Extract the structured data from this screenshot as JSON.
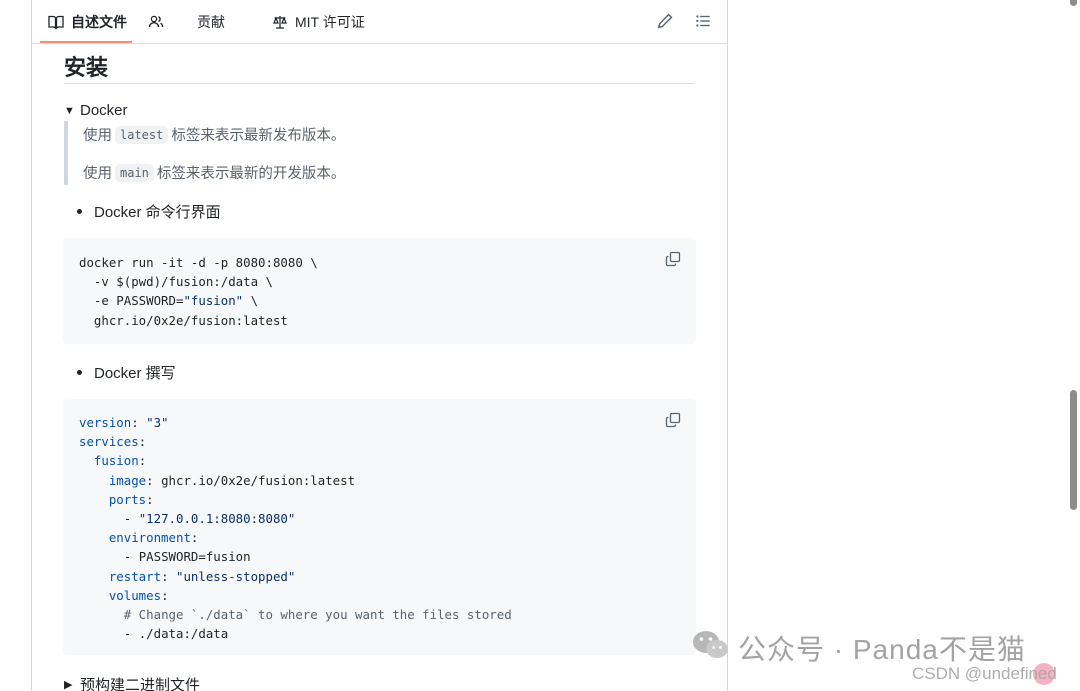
{
  "tabs": {
    "readme": "自述文件",
    "contributors": "贡献",
    "license": "MIT 许可证"
  },
  "content": {
    "heading": "安装",
    "docker_summary": "Docker",
    "quote": {
      "line1_pre": "使用",
      "line1_code": "latest",
      "line1_post": "标签来表示最新发布版本。",
      "line2_pre": "使用",
      "line2_code": "main",
      "line2_post": "标签来表示最新的开发版本。"
    },
    "bullet_cli": "Docker 命令行界面",
    "cli_code": {
      "l1": "docker run -it -d -p 8080:8080 \\",
      "l2": "  -v $(pwd)/fusion:/data \\",
      "l3a": "  -e PASSWORD=",
      "l3b": "\"fusion\"",
      "l3c": " \\",
      "l4": "  ghcr.io/0x2e/fusion:latest"
    },
    "bullet_compose": "Docker 撰写",
    "compose_code": {
      "version_k": "version",
      "version_v": "\"3\"",
      "services_k": "services",
      "fusion_k": "fusion",
      "image_k": "image",
      "image_v": "ghcr.io/0x2e/fusion:latest",
      "ports_k": "ports",
      "ports_v": "\"127.0.0.1:8080:8080\"",
      "env_k": "environment",
      "env_v": "PASSWORD=fusion",
      "restart_k": "restart",
      "restart_v": "\"unless-stopped\"",
      "volumes_k": "volumes",
      "comment": "# Change `./data` to where you want the files stored",
      "vol_v": "./data:/data"
    },
    "prebuilt_summary": "预构建二进制文件"
  },
  "watermark": {
    "main": "公众号 · Panda不是猫",
    "sub": "CSDN @undefined"
  },
  "icons": [
    "book-icon",
    "people-icon",
    "law-icon",
    "pencil-icon",
    "list-icon",
    "copy-icon",
    "wechat-icon"
  ]
}
